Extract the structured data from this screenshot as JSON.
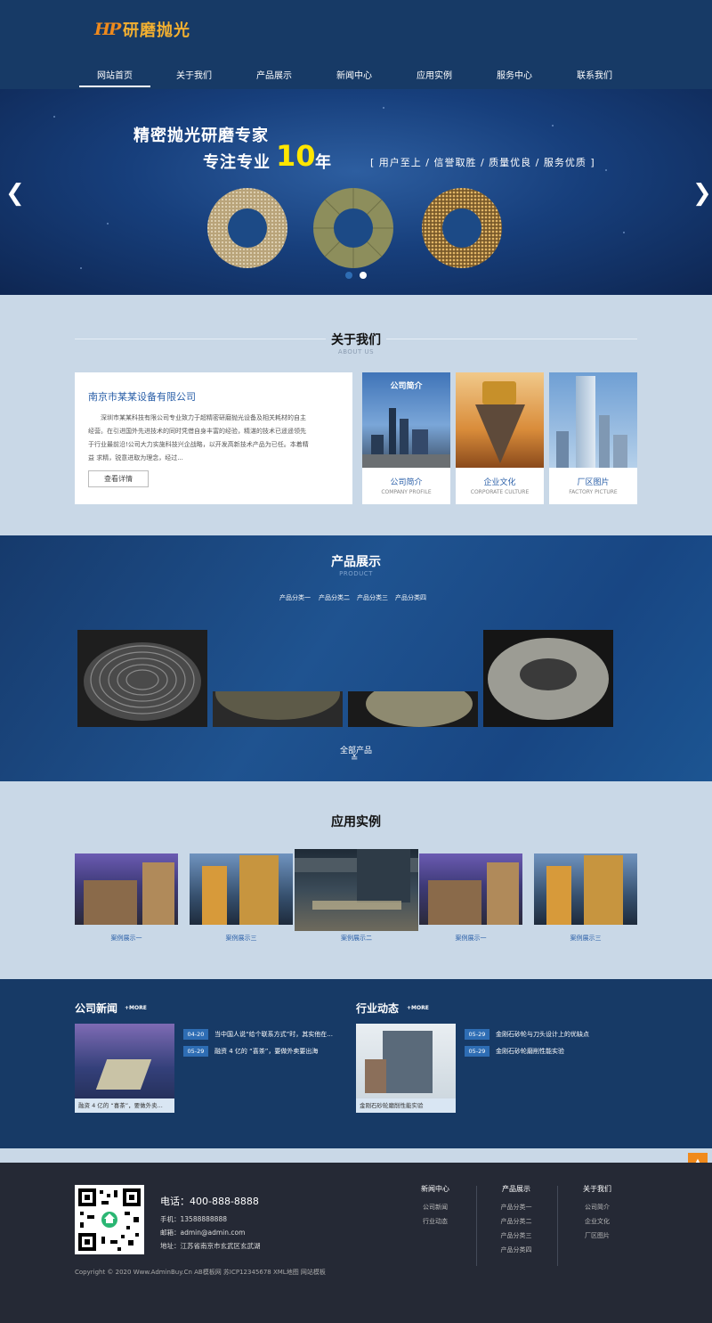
{
  "header": {
    "logo_mark": "HP",
    "logo_text": "研磨抛光",
    "nav": [
      "网站首页",
      "关于我们",
      "产品展示",
      "新闻中心",
      "应用实例",
      "服务中心",
      "联系我们"
    ]
  },
  "banner": {
    "slogan1": "精密抛光研磨专家",
    "slogan2": "专注专业",
    "number": "10",
    "year": "年",
    "tagline": "[ 用户至上 / 信誉取胜 / 质量优良 / 服务优质 ]",
    "prev": "❮",
    "next": "❯"
  },
  "about": {
    "title": "关于我们",
    "subtitle": "ABOUT US",
    "company": "南京市某某设备有限公司",
    "text": "深圳市某某科技有限公司专业致力于超精密研磨抛光设备及相关耗材的自主经营。在引进国外先进技术的同时凭借自身丰富的经验，精湛的技术已遥遥领先于行业最前沿!公司大力实施科技兴企战略，以开发高新技术产品为已任。本着精益 求精，锐意进取为理念，经过...",
    "button": "查看详情",
    "tiles": [
      {
        "title": "公司简介",
        "en": "COMPANY PROFILE",
        "overlay": "公司简介"
      },
      {
        "title": "企业文化",
        "en": "CORPORATE CULTURE"
      },
      {
        "title": "厂区图片",
        "en": "FACTORY PICTURE"
      }
    ]
  },
  "product": {
    "title": "产品展示",
    "subtitle": "PRODUCT",
    "categories": [
      "产品分类一",
      "产品分类二",
      "产品分类三",
      "产品分类四"
    ],
    "all": "全部产品",
    "all_icon": "≚"
  },
  "cases": {
    "title": "应用实例",
    "items": [
      "案例展示一",
      "案例展示三",
      "案例展示二",
      "案例展示一",
      "案例展示三"
    ]
  },
  "news": {
    "company": {
      "title": "公司新闻",
      "more": "+MORE",
      "thumb_caption": "融资 4 亿的 “喜茶”，要做外卖...",
      "items": [
        {
          "date": "04-20",
          "text": "当中国人说“给个联系方式”时，其实他在..."
        },
        {
          "date": "05-29",
          "text": "融资 4 亿的 “喜茶”，要做外卖要出海"
        }
      ]
    },
    "industry": {
      "title": "行业动态",
      "more": "+MORE",
      "thumb_caption": "金刚石砂轮磨削性能实验",
      "items": [
        {
          "date": "05-29",
          "text": "金刚石砂轮与刀头设计上的优缺点"
        },
        {
          "date": "05-29",
          "text": "金刚石砂轮磨削性能实验"
        }
      ]
    }
  },
  "footer": {
    "phone": "电话：400-888-8888",
    "mobile": "手机：13588888888",
    "email": "邮箱：admin@admin.com",
    "address": "地址：江苏省南京市玄武区玄武湖",
    "copyright": "Copyright © 2020 Www.AdminBuy.Cn AB模板网  苏ICP12345678  XML地图  网站模板",
    "totop": "▲",
    "cols": [
      {
        "title": "新闻中心",
        "links": [
          "公司新闻",
          "行业动态"
        ]
      },
      {
        "title": "产品展示",
        "links": [
          "产品分类一",
          "产品分类二",
          "产品分类三",
          "产品分类四"
        ]
      },
      {
        "title": "关于我们",
        "links": [
          "公司简介",
          "企业文化",
          "厂区图片"
        ]
      }
    ]
  },
  "colors": {
    "header_bg": "#173a66",
    "accent": "#2e6db4",
    "page_bg": "#c9d8e7",
    "footer_bg": "#252935",
    "logo_orange": "#f08a1c"
  }
}
